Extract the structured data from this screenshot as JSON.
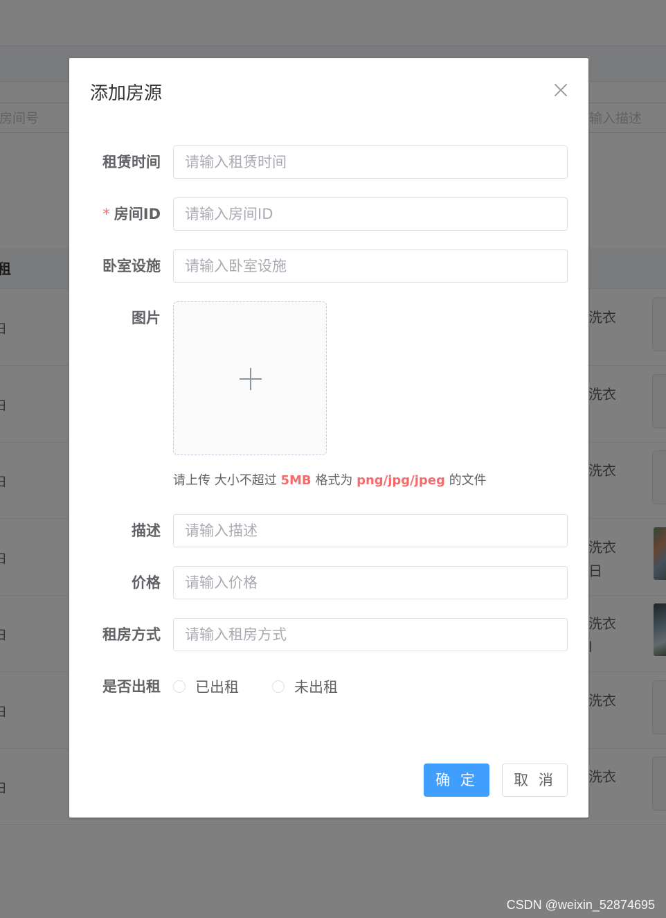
{
  "background": {
    "search_left": "房间号",
    "search_right": "输入描述",
    "table_head_fragment": "租",
    "rows": [
      {
        "left": "日",
        "right": [
          "洗衣"
        ],
        "thumb": false
      },
      {
        "left": "日",
        "right": [
          "洗衣"
        ],
        "thumb": false
      },
      {
        "left": "日",
        "right": [
          "洗衣"
        ],
        "thumb": false
      },
      {
        "left": "日",
        "right": [
          "洗衣",
          "日"
        ],
        "thumb": true
      },
      {
        "left": "日",
        "right": [
          "洗衣",
          "l"
        ],
        "thumb": true
      },
      {
        "left": "日",
        "right": [
          "洗衣"
        ],
        "thumb": false
      },
      {
        "left": "日",
        "right": [
          "洗衣"
        ],
        "thumb": false
      }
    ],
    "watermark": "CSDN @weixin_52874695"
  },
  "dialog": {
    "title": "添加房源",
    "fields": {
      "lease_time": {
        "label": "租赁时间",
        "placeholder": "请输入租赁时间",
        "value": ""
      },
      "room_id": {
        "label": "房间ID",
        "required_mark": "*",
        "placeholder": "请输入房间ID",
        "value": ""
      },
      "bedroom": {
        "label": "卧室设施",
        "placeholder": "请输入卧室设施",
        "value": ""
      },
      "image": {
        "label": "图片",
        "tip_prefix": "请上传 大小不超过 ",
        "tip_size": "5MB",
        "tip_middle": " 格式为 ",
        "tip_formats": "png/jpg/jpeg",
        "tip_suffix": " 的文件"
      },
      "description": {
        "label": "描述",
        "placeholder": "请输入描述",
        "value": ""
      },
      "price": {
        "label": "价格",
        "placeholder": "请输入价格",
        "value": ""
      },
      "rent_type": {
        "label": "租房方式",
        "placeholder": "请输入租房方式",
        "value": ""
      },
      "rented": {
        "label": "是否出租",
        "options": [
          "已出租",
          "未出租"
        ]
      }
    },
    "confirm_label": "确 定",
    "cancel_label": "取 消"
  },
  "colors": {
    "primary": "#409eff",
    "danger": "#f56c6c",
    "mask": "rgba(0,0,0,0.5)"
  }
}
